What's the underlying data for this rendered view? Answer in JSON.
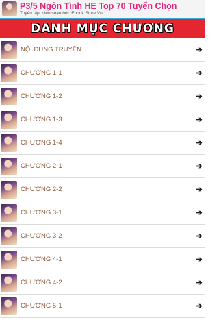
{
  "header": {
    "title": "P3/5 Ngôn Tình HE Top 70 Tuyển Chọn",
    "subtitle": "Tuyển tập, biên soạn bởi: Ebook Store Vn",
    "icon": "app-book-cover-icon"
  },
  "banner": {
    "title": "DANH MỤC CHƯƠNG"
  },
  "chapters": [
    "NỘI DUNG TRUYỆN",
    "CHƯƠNG 1-1",
    "CHƯƠNG 1-2",
    "CHƯƠNG 1-3",
    "CHƯƠNG 1-4",
    "CHƯƠNG 2-1",
    "CHƯƠNG 2-2",
    "CHƯƠNG 3-1",
    "CHƯƠNG 3-2",
    "CHƯƠNG 4-1",
    "CHƯƠNG 4-2",
    "CHƯƠNG 5-1"
  ],
  "arrow_icon": "arrow-right-icon",
  "colors": {
    "title": "#e0257d",
    "banner": "#e3262f",
    "label": "#8b5a3c",
    "header_border": "#35a7d9"
  }
}
